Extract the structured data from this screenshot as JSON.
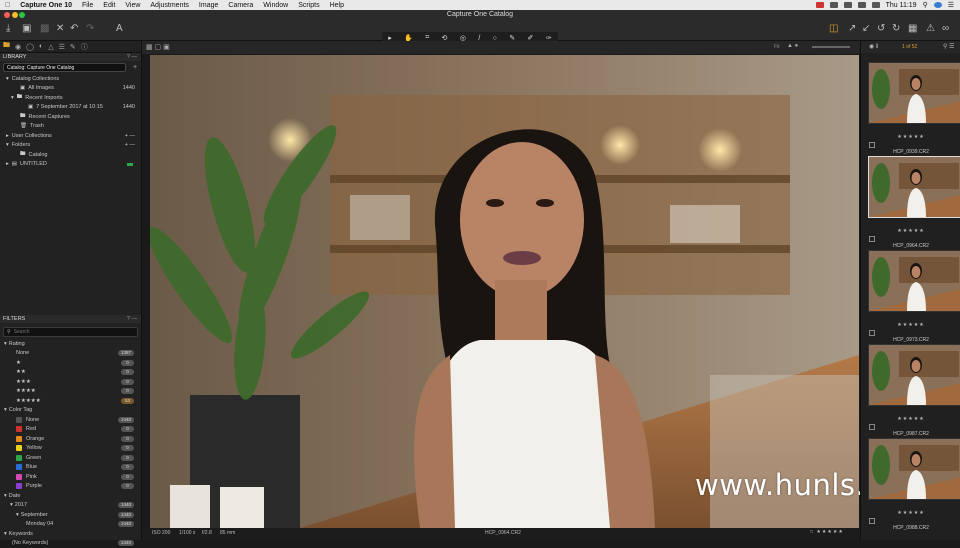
{
  "menubar": {
    "app_name": "Capture One 10",
    "items": [
      "File",
      "Edit",
      "View",
      "Adjustments",
      "Image",
      "Camera",
      "Window",
      "Scripts",
      "Help"
    ],
    "clock": "Thu 11:19"
  },
  "window": {
    "title": "Capture One Catalog"
  },
  "toolbar": {
    "icons": [
      "import-icon",
      "capture-icon",
      "tray-icon",
      "delete-icon",
      "undo-icon",
      "redo-icon",
      "text-icon"
    ],
    "cursor_tools": [
      "▸",
      "✋",
      "⌗",
      "⟲",
      "◎",
      "/",
      "○",
      "✎",
      "✐",
      "✑"
    ]
  },
  "left": {
    "library_header": "LIBRARY",
    "catalog_select": "Catalog: Capture One Catalog",
    "catalog_collections": "Catalog Collections",
    "all_images": "All Images",
    "all_images_count": "1440",
    "recent_imports": "Recent Imports",
    "import_date": "7 September 2017 at 10:15",
    "import_count": "1440",
    "recent_captures": "Recent Captures",
    "trash": "Trash",
    "user_collections": "User Collections",
    "folders": "Folders",
    "catalog": "Catalog",
    "untitled": "UNTITLED",
    "filters_header": "FILTERS",
    "search_placeholder": "Search",
    "rating_header": "Rating",
    "ratings": [
      {
        "label": "None",
        "count": "1387"
      },
      {
        "label": "★",
        "count": "0"
      },
      {
        "label": "★★",
        "count": "0"
      },
      {
        "label": "★★★",
        "count": "0"
      },
      {
        "label": "★★★★",
        "count": "0"
      },
      {
        "label": "★★★★★",
        "count": "53"
      }
    ],
    "color_tag_header": "Color Tag",
    "color_tags": [
      {
        "label": "None",
        "count": "1440",
        "color": "#555555"
      },
      {
        "label": "Red",
        "count": "0",
        "color": "#d0312d"
      },
      {
        "label": "Orange",
        "count": "0",
        "color": "#e88a1a"
      },
      {
        "label": "Yellow",
        "count": "0",
        "color": "#e8d21a"
      },
      {
        "label": "Green",
        "count": "0",
        "color": "#2ea84a"
      },
      {
        "label": "Blue",
        "count": "0",
        "color": "#2a6fd6"
      },
      {
        "label": "Pink",
        "count": "0",
        "color": "#d64ab5"
      },
      {
        "label": "Purple",
        "count": "0",
        "color": "#8a3fd1"
      }
    ],
    "date_header": "Date",
    "year": "2017",
    "year_count": "1440",
    "month": "September",
    "month_count": "1440",
    "day": "Monday 04",
    "day_count": "1440",
    "keywords_header": "Keywords",
    "no_keywords": "(No Keywords)",
    "no_keywords_count": "1440"
  },
  "viewer": {
    "counter": "1 of 52",
    "iso": "ISO 200",
    "shutter": "1/100 s",
    "aperture": "f/2.8",
    "focal": "85 mm",
    "filename": "HCP_0964.CR2"
  },
  "filmstrip": [
    {
      "name": "HCP_0939.CR2",
      "stars": "★★★★★",
      "selected": false
    },
    {
      "name": "HCP_0964.CR2",
      "stars": "★★★★★",
      "selected": true
    },
    {
      "name": "HCP_0973.CR2",
      "stars": "★★★★★",
      "selected": false
    },
    {
      "name": "HCP_0987.CR2",
      "stars": "★★★★★",
      "selected": false
    },
    {
      "name": "HCP_0988.CR2",
      "stars": "★★★★★",
      "selected": false
    }
  ],
  "watermark": "www.hunls.com",
  "colors": {
    "accent": "#e0a030",
    "selected_border": "#dddddd",
    "panel": "#222222"
  }
}
